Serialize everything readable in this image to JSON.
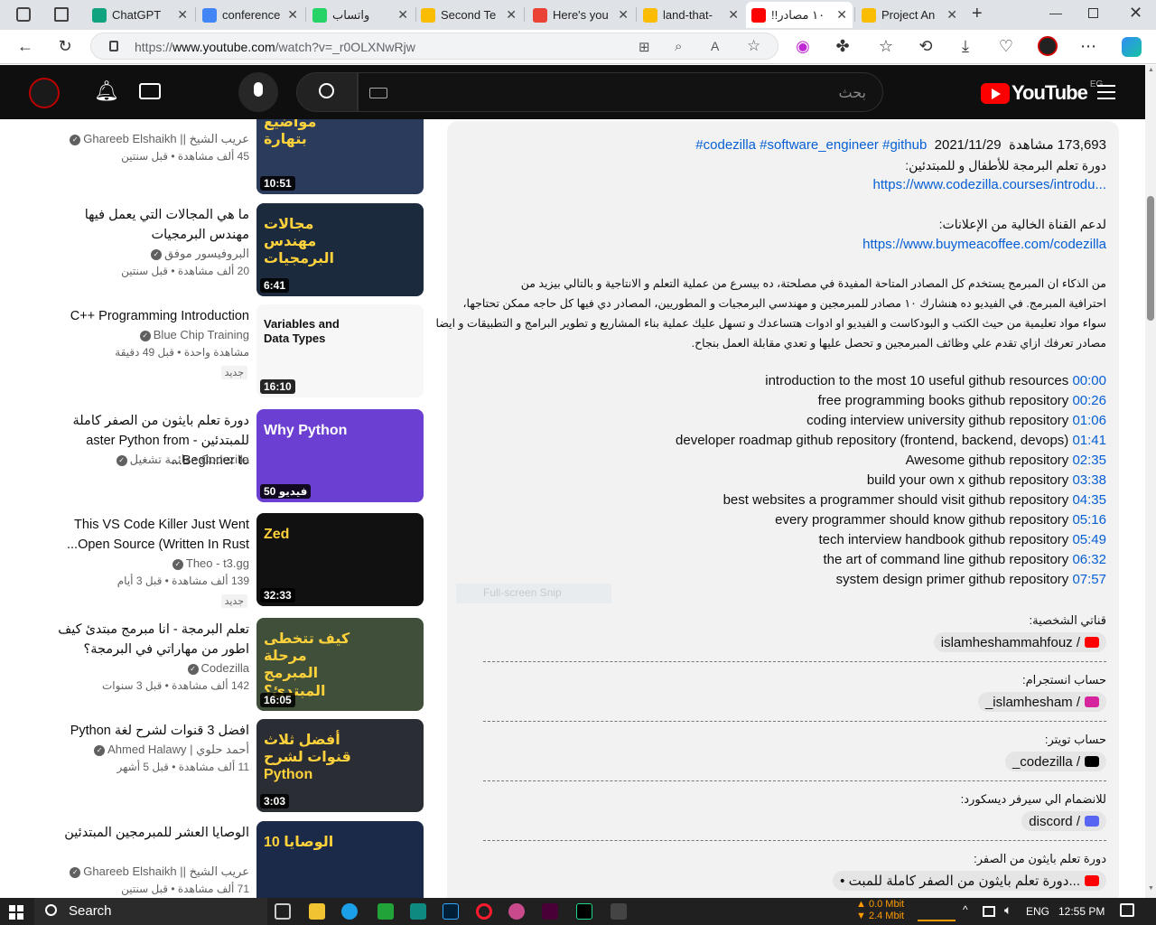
{
  "tabs": [
    {
      "label": "ChatGPT",
      "color": "#10a37f"
    },
    {
      "label": "conference",
      "color": "#4285f4"
    },
    {
      "label": "واتساب",
      "color": "#25d366"
    },
    {
      "label": "Second Te",
      "color": "#fbbc04"
    },
    {
      "label": "Here's you",
      "color": "#ea4335"
    },
    {
      "label": "land-that-",
      "color": "#fbbc04"
    },
    {
      "label": "!!١٠ مصادر",
      "color": "#ff0000"
    },
    {
      "label": "Project An",
      "color": "#fbbc04"
    }
  ],
  "address": {
    "prefix": "https://",
    "host": "www.youtube.com",
    "path": "/watch?v=_r0OLXNwRjw"
  },
  "youtube": {
    "logo": "YouTube",
    "region": "EG",
    "search_placeholder": "بحث"
  },
  "videos": [
    {
      "title": "",
      "channel": "عريب الشيخ || Ghareeb Elshaikh",
      "meta": "45 ألف مشاهدة • قبل سنتين",
      "duration": "10:51",
      "thumb_text": "مواضيع بتهارة",
      "badge": ""
    },
    {
      "title": "ما هي المجالات التي يعمل فيها مهندس البرمجيات",
      "channel": "البروفيسور موفق",
      "meta": "20 ألف مشاهدة • قبل سنتين",
      "duration": "6:41",
      "thumb_text": "مجالات مهندس البرمجيات",
      "badge": ""
    },
    {
      "title": "C++ Programming Introduction",
      "channel": "Blue Chip Training",
      "meta": "مشاهدة واحدة • قبل 49 دقيقة",
      "duration": "16:10",
      "thumb_text": "Variables and Data Types",
      "badge": "جديد"
    },
    {
      "title": "دورة تعلم بايثون من الصفر كاملة للمبتدئين - aster Python from Beginner to...",
      "channel": "Codezilla • قائمة تشغيل",
      "meta": "",
      "duration": "50 فيديو",
      "thumb_text": "Why Python",
      "badge": ""
    },
    {
      "title": "This VS Code Killer Just Went Open Source (Written In Rust...",
      "channel": "Theo - t3.gg",
      "meta": "139 ألف مشاهدة • قبل 3 أيام",
      "duration": "32:33",
      "thumb_text": "Zed",
      "badge": "جديد"
    },
    {
      "title": "تعلم البرمجة - انا مبرمج مبتدئ كيف اطور من مهاراتي في البرمجة؟",
      "channel": "Codezilla",
      "meta": "142 ألف مشاهدة • قبل 3 سنوات",
      "duration": "16:05",
      "thumb_text": "كيف تتخطى مرحلة المبرمج المبتدئ؟",
      "badge": ""
    },
    {
      "title": "افضل 3 قنوات لشرح لغة Python",
      "channel": "أحمد حلوي | Ahmed Halawy",
      "meta": "11 ألف مشاهدة • قبل 5 أشهر",
      "duration": "3:03",
      "thumb_text": "أفضل ثلاث قنوات لشرح Python",
      "badge": ""
    },
    {
      "title": "الوصايا العشر للمبرمجين المبتدئين",
      "channel": "عريب الشيخ || Ghareeb Elshaikh",
      "meta": "71 ألف مشاهدة • قبل سنتين",
      "duration": "",
      "thumb_text": "الوصايا 10",
      "badge": ""
    }
  ],
  "description": {
    "views": "173,693 مشاهدة",
    "date": "2021/11/29",
    "tags": "#codezilla #software_engineer #github",
    "course_label": "دورة تعلم البرمجة للأطفال و للمبتدئين:",
    "course_link": "https://www.codezilla.courses/introdu...",
    "support_label": "لدعم القناة الخالية من الإعلانات:",
    "support_link": "https://www.buymeacoffee.com/codezilla",
    "para1": "من الذكاء ان المبرمج يستخدم كل المصادر المتاحة المفيدة في مصلحتة، ده بيسرع من عملية التعلم و الانتاجية و بالتالي بيزيد من",
    "para2": "احترافية المبرمج. في الفيديو ده هنشارك ١٠ مصادر للمبرمجين و مهندسي البرمجيات و المطوريين، المصادر دي فيها كل حاجه ممكن تحتاجها،",
    "para3": "سواء مواد تعليمية من حيث الكتب و البودكاست و الفيديو او ادوات هتساعدك و تسهل عليك عملية بناء المشاريع و تطوير البرامج و التطبيقات و ايضا",
    "para4": "مصادر تعرفك ازاي تقدم علي وظائف المبرمجين و تحصل عليها و تعدي مقابلة العمل بنجاح.",
    "chapters": [
      {
        "time": "00:00",
        "text": "introduction to the most 10 useful github resources"
      },
      {
        "time": "00:26",
        "text": "free programming books github repository"
      },
      {
        "time": "01:06",
        "text": "coding interview university github repository"
      },
      {
        "time": "01:41",
        "text": "developer roadmap github repository (frontend, backend, devops)"
      },
      {
        "time": "02:35",
        "text": "Awesome github repository"
      },
      {
        "time": "03:38",
        "text": "build your own x github repository"
      },
      {
        "time": "04:35",
        "text": "best websites a programmer should visit github repository"
      },
      {
        "time": "05:16",
        "text": "every programmer should know github repository"
      },
      {
        "time": "05:49",
        "text": "tech interview handbook github repository"
      },
      {
        "time": "06:32",
        "text": "the art of command line github repository"
      },
      {
        "time": "07:57",
        "text": "system design primer github repository"
      }
    ],
    "snip_text": "Full-screen Snip",
    "socials": [
      {
        "label": "قناتي الشخصية:",
        "handle": "islamheshammahfouz /",
        "color": "#ff0000"
      },
      {
        "label": "حساب انستجرام:",
        "handle": "_islamhesham /",
        "color": "#d6249f"
      },
      {
        "label": "حساب تويتر:",
        "handle": "_codezilla /",
        "color": "#000000"
      },
      {
        "label": "للانضمام الي سيرفر ديسكورد:",
        "handle": "discord /",
        "color": "#5865f2"
      },
      {
        "label": "دورة تعلم بايثون من الصفر:",
        "handle": "• دورة تعلم بايثون من الصفر كاملة للمبت...",
        "color": "#ff0000"
      }
    ]
  },
  "taskbar": {
    "search": "Search",
    "net_up": "0.0 Mbit",
    "net_down": "2.4 Mbit",
    "lang": "ENG",
    "time": "12:55 PM"
  }
}
